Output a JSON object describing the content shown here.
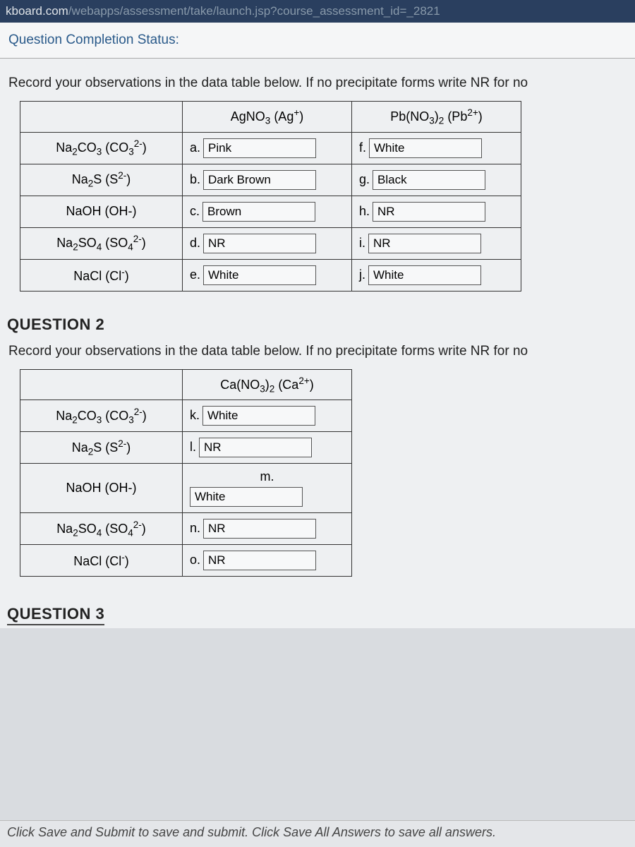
{
  "url": {
    "prefix": "kboard.com",
    "path": "/webapps/assessment/take/launch.jsp?course_assessment_id=_2821"
  },
  "completion_status": "Question Completion Status:",
  "q1": {
    "instruction": "Record your observations in the data table below.  If no precipitate forms write NR for no",
    "col_headers": {
      "c1": {
        "base": "AgNO",
        "sub1": "3",
        "ion": " (Ag",
        "sup": "+",
        "close": ")"
      },
      "c2": {
        "base": "Pb(NO",
        "sub1": "3",
        "close1": ")",
        "sub2": "2",
        "ion": " (Pb",
        "sup": "2+",
        "close": ")"
      }
    },
    "rows": [
      {
        "label": {
          "base": "Na",
          "sub1": "2",
          "mid": "CO",
          "sub2": "3",
          "ion": " (CO",
          "sub3": "3",
          "sup": "2-",
          "close": ")"
        },
        "a_letter": "a.",
        "a_val": "Pink",
        "b_letter": "f.",
        "b_val": "White"
      },
      {
        "label": {
          "base": "Na",
          "sub1": "2",
          "mid": "S",
          "ion": " (S",
          "sup": "2-",
          "close": ")"
        },
        "a_letter": "b.",
        "a_val": "Dark Brown",
        "b_letter": "g.",
        "b_val": "Black"
      },
      {
        "label": {
          "plain": "NaOH (OH-)"
        },
        "a_letter": "c.",
        "a_val": "Brown",
        "b_letter": "h.",
        "b_val": "NR"
      },
      {
        "label": {
          "base": "Na",
          "sub1": "2",
          "mid": "SO",
          "sub2": "4",
          "ion": " (SO",
          "sub3": "4",
          "sup": "2-",
          "close": ")"
        },
        "a_letter": "d.",
        "a_val": "NR",
        "b_letter": "i.",
        "b_val": "NR"
      },
      {
        "label": {
          "base": "NaCl (Cl",
          "sup": "-",
          "close": ")"
        },
        "a_letter": "e.",
        "a_val": "White",
        "b_letter": "j.",
        "b_val": "White"
      }
    ]
  },
  "q2": {
    "heading": "QUESTION 2",
    "instruction": "Record your observations in the data table below.  If no precipitate forms write NR for no",
    "col_header": {
      "base": "Ca(NO",
      "sub1": "3",
      "close1": ")",
      "sub2": "2",
      "ion": " (Ca",
      "sup": "2+",
      "close": ")"
    },
    "rows": [
      {
        "label": {
          "base": "Na",
          "sub1": "2",
          "mid": "CO",
          "sub2": "3",
          "ion": " (CO",
          "sub3": "3",
          "sup": "2-",
          "close": ")"
        },
        "letter": "k.",
        "val": "White"
      },
      {
        "label": {
          "base": "Na",
          "sub1": "2",
          "mid": "S",
          "ion": " (S",
          "sup": "2-",
          "close": ")"
        },
        "letter": "l.",
        "val": "NR"
      },
      {
        "label": {
          "plain": "NaOH (OH-)"
        },
        "letter": "m.",
        "val": "White",
        "stacked": true
      },
      {
        "label": {
          "base": "Na",
          "sub1": "2",
          "mid": "SO",
          "sub2": "4",
          "ion": " (SO",
          "sub3": "4",
          "sup": "2-",
          "close": ")"
        },
        "letter": "n.",
        "val": "NR"
      },
      {
        "label": {
          "base": "NaCl (Cl",
          "sup": "-",
          "close": ")"
        },
        "letter": "o.",
        "val": "NR"
      }
    ]
  },
  "q3_heading": "QUESTION 3",
  "footer": "Click Save and Submit to save and submit. Click Save All Answers to save all answers."
}
